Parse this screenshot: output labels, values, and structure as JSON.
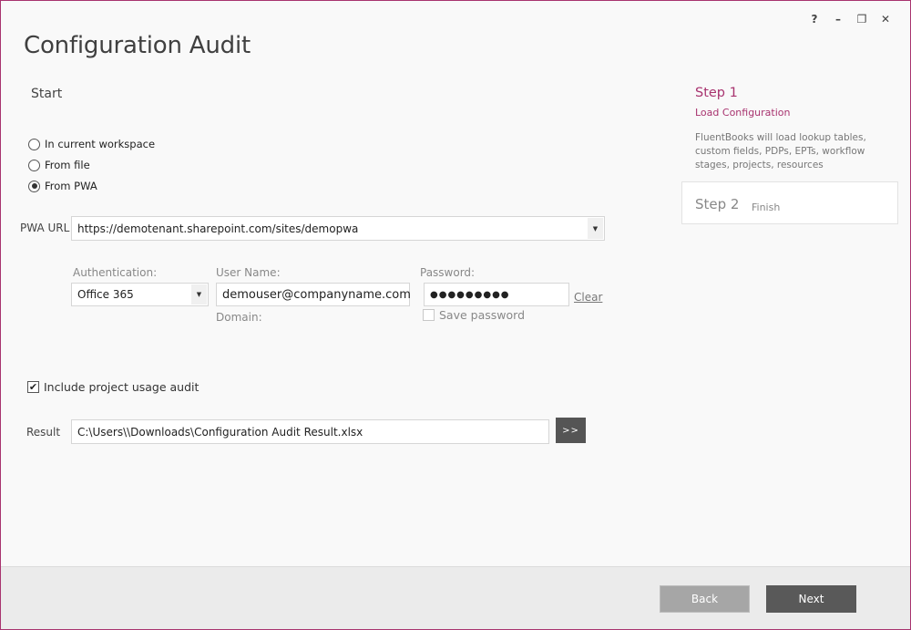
{
  "window": {
    "title": "Configuration Audit",
    "controls": {
      "help": "?",
      "minimize": "–",
      "restore": "❐",
      "close": "✕"
    }
  },
  "start": {
    "heading": "Start",
    "source_options": [
      {
        "label": "In current workspace",
        "checked": false
      },
      {
        "label": "From file",
        "checked": false
      },
      {
        "label": "From PWA",
        "checked": true
      }
    ]
  },
  "pwa": {
    "url_label": "PWA URL",
    "url_value": "https://demotenant.sharepoint.com/sites/demopwa"
  },
  "auth": {
    "authentication_label": "Authentication:",
    "authentication_value": "Office 365",
    "username_label": "User Name:",
    "username_value": "demouser@companyname.com",
    "domain_label": "Domain:",
    "password_label": "Password:",
    "password_value": "●●●●●●●●●",
    "clear_label": "Clear",
    "save_password_label": "Save password",
    "save_password_checked": false
  },
  "options": {
    "usage_audit_label": "Include project usage audit",
    "usage_audit_checked": true
  },
  "result": {
    "label": "Result",
    "path": "C:\\Users\\\\Downloads\\Configuration Audit Result.xlsx",
    "browse_label": ">>"
  },
  "steps": {
    "step1_title": "Step 1",
    "step1_subtitle": "Load Configuration",
    "step1_description": "FluentBooks will load lookup tables, custom fields, PDPs, EPTs, workflow stages, projects, resources",
    "step2_title": "Step 2",
    "step2_subtitle": "Finish"
  },
  "footer": {
    "back_label": "Back",
    "next_label": "Next"
  },
  "colors": {
    "accent": "#a8336f",
    "button_dark": "#595959",
    "button_disabled": "#a6a6a6"
  }
}
